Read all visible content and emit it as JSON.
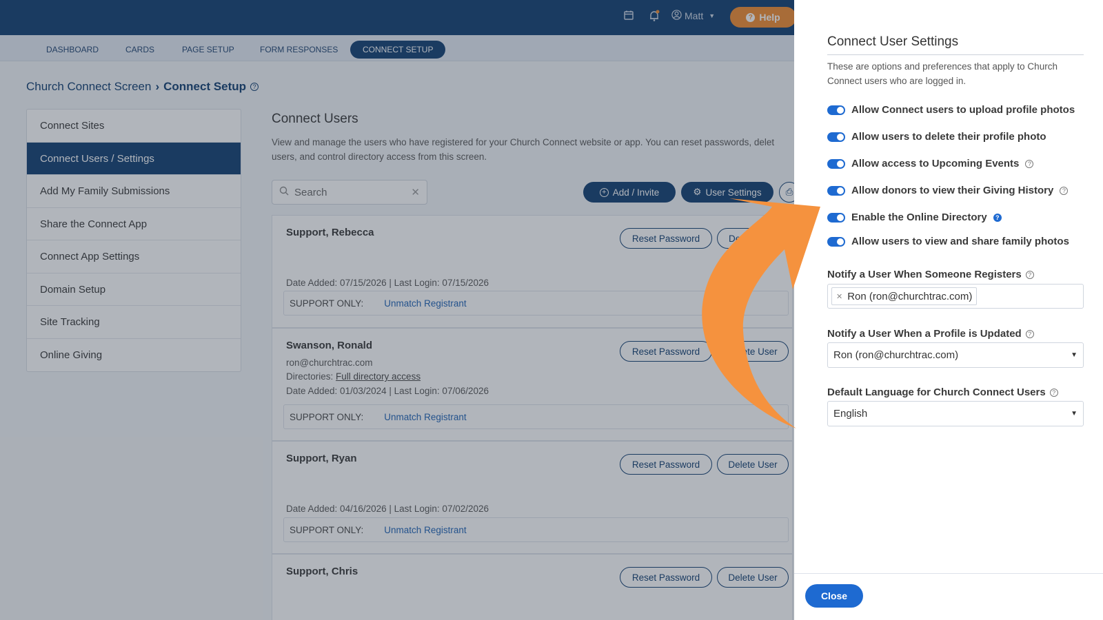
{
  "topbar": {
    "calendar_icon": "calendar-icon",
    "bell_icon": "bell-icon",
    "user_name": "Matt",
    "help_label": "Help"
  },
  "nav": {
    "tabs": [
      "DASHBOARD",
      "CARDS",
      "PAGE SETUP",
      "FORM RESPONSES",
      "CONNECT SETUP"
    ],
    "active": "CONNECT SETUP"
  },
  "breadcrumb": {
    "parent": "Church Connect Screen",
    "current": "Connect Setup"
  },
  "sidebar": {
    "items": [
      {
        "label": "Connect Sites"
      },
      {
        "label": "Connect Users / Settings"
      },
      {
        "label": "Add My Family Submissions"
      },
      {
        "label": "Share the Connect App"
      },
      {
        "label": "Connect App Settings"
      },
      {
        "label": "Domain Setup"
      },
      {
        "label": "Site Tracking"
      },
      {
        "label": "Online Giving"
      }
    ]
  },
  "main": {
    "title": "Connect Users",
    "description": "View and manage the users who have registered for your Church Connect website or app. You can reset passwords, delet users, and control directory access from this screen.",
    "search_placeholder": "Search",
    "add_invite_label": "Add / Invite",
    "user_settings_label": "User Settings"
  },
  "users": [
    {
      "name": "Support, Rebecca",
      "email": "",
      "directories_label": "",
      "directories_link": "",
      "date_line": "Date Added: 07/15/2026 | Last Login: 07/15/2026",
      "reset_label": "Reset Password",
      "delete_label": "De",
      "support_label": "SUPPORT ONLY:",
      "unmatch_label": "Unmatch Registrant"
    },
    {
      "name": "Swanson, Ronald",
      "email": "ron@churchtrac.com",
      "directories_label": "Directories:",
      "directories_link": "Full directory access",
      "date_line": "Date Added: 01/03/2024 | Last Login: 07/06/2026",
      "reset_label": "Reset Password",
      "delete_label": "Delete User",
      "support_label": "SUPPORT ONLY:",
      "unmatch_label": "Unmatch Registrant"
    },
    {
      "name": "Support, Ryan",
      "email": "",
      "directories_label": "",
      "directories_link": "",
      "date_line": "Date Added: 04/16/2026 | Last Login: 07/02/2026",
      "reset_label": "Reset Password",
      "delete_label": "Delete User",
      "support_label": "SUPPORT ONLY:",
      "unmatch_label": "Unmatch Registrant"
    },
    {
      "name": "Support, Chris",
      "reset_label": "Reset Password",
      "delete_label": "Delete User"
    }
  ],
  "panel": {
    "title": "Connect User Settings",
    "description": "These are options and preferences that apply to Church Connect users who are logged in.",
    "toggles": [
      {
        "label": "Allow Connect users to upload profile photos",
        "on": true
      },
      {
        "label": "Allow users to delete their profile photo",
        "on": true
      },
      {
        "label": "Allow access to Upcoming Events",
        "on": true
      },
      {
        "label": "Allow donors to view their Giving History",
        "on": true
      },
      {
        "label": "Enable the Online Directory",
        "on": true
      },
      {
        "label": "Allow users to view and share family photos",
        "on": true
      }
    ],
    "notify_register_label": "Notify a User When Someone Registers",
    "notify_register_tag": "Ron (ron@churchtrac.com)",
    "notify_profile_label": "Notify a User When a Profile is Updated",
    "notify_profile_value": "Ron (ron@churchtrac.com)",
    "language_label": "Default Language for Church Connect Users",
    "language_value": "English",
    "close_label": "Close"
  },
  "colors": {
    "brand_navy": "#0c3a6e",
    "help_orange": "#f08a2c",
    "toggle_blue": "#1e6ad1",
    "annotation_arrow": "#f5923e"
  }
}
